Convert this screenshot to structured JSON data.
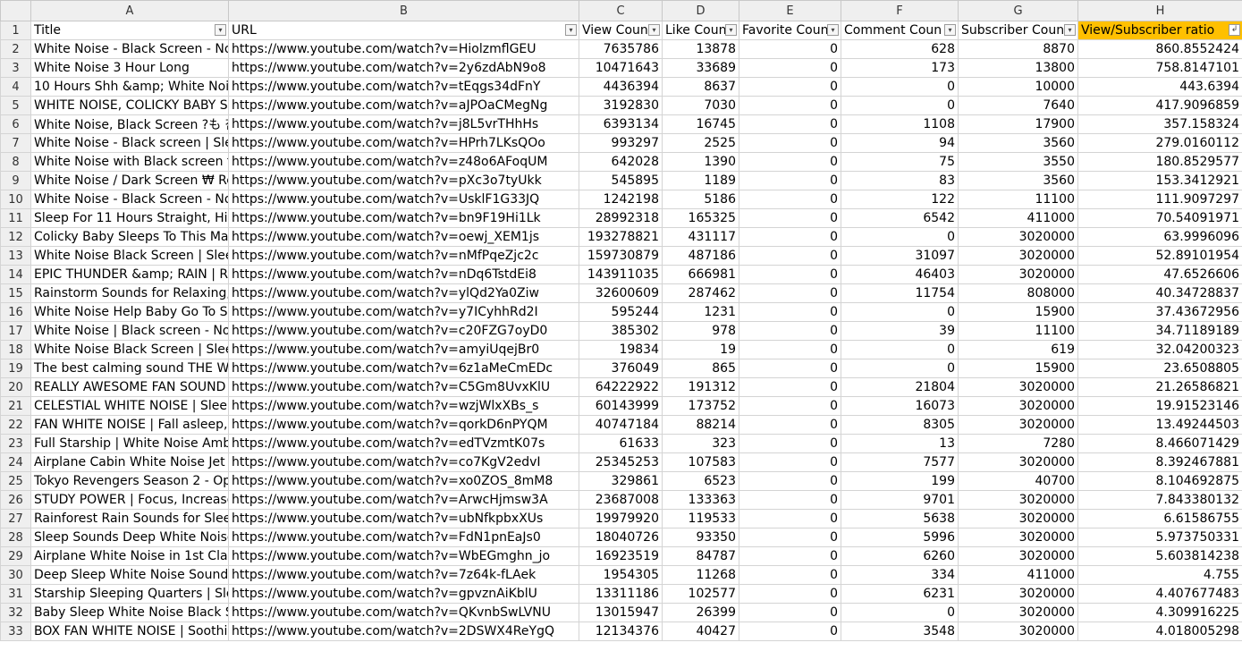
{
  "columns": [
    "A",
    "B",
    "C",
    "D",
    "E",
    "F",
    "G",
    "H"
  ],
  "field_headers": [
    "Title",
    "URL",
    "View Coun",
    "Like Coun",
    "Favorite Coun",
    "Comment Coun",
    "Subscriber Coun",
    "View/Subscriber ratio"
  ],
  "filter_icons": {
    "dropdown": "▾",
    "sorted_desc": "↲"
  },
  "highlight_color": "#ffc000",
  "rows": [
    {
      "n": "2",
      "cells": [
        "White Noise - Black Screen - No",
        "https://www.youtube.com/watch?v=HiolzmflGEU",
        "7635786",
        "13878",
        "0",
        "628",
        "8870",
        "860.8552424"
      ]
    },
    {
      "n": "3",
      "cells": [
        "White Noise 3 Hour Long",
        "https://www.youtube.com/watch?v=2y6zdAbN9o8",
        "10471643",
        "33689",
        "0",
        "173",
        "13800",
        "758.8147101"
      ]
    },
    {
      "n": "4",
      "cells": [
        "10 Hours Shh &amp; White Nois",
        "https://www.youtube.com/watch?v=tEqgs34dFnY",
        "4436394",
        "8637",
        "0",
        "0",
        "10000",
        "443.6394"
      ]
    },
    {
      "n": "5",
      "cells": [
        "WHITE NOISE, COLICKY BABY SL",
        "https://www.youtube.com/watch?v=aJPOaCMegNg",
        "3192830",
        "7030",
        "0",
        "0",
        "7640",
        "417.9096859"
      ]
    },
    {
      "n": "6",
      "cells": [
        "White Noise, Black Screen ?も 참",
        "https://www.youtube.com/watch?v=j8L5vrTHhHs",
        "6393134",
        "16745",
        "0",
        "1108",
        "17900",
        "357.158324"
      ]
    },
    {
      "n": "7",
      "cells": [
        "White Noise - Black screen | Sle",
        "https://www.youtube.com/watch?v=HPrh7LKsQOo",
        "993297",
        "2525",
        "0",
        "94",
        "3560",
        "279.0160112"
      ]
    },
    {
      "n": "8",
      "cells": [
        "White Noise with Black screen fo",
        "https://www.youtube.com/watch?v=z48o6AFoqUM",
        "642028",
        "1390",
        "0",
        "75",
        "3550",
        "180.8529577"
      ]
    },
    {
      "n": "9",
      "cells": [
        "White Noise / Dark Screen ₩ Re",
        "https://www.youtube.com/watch?v=pXc3o7tyUkk",
        "545895",
        "1189",
        "0",
        "83",
        "3560",
        "153.3412921"
      ]
    },
    {
      "n": "10",
      "cells": [
        "White Noise - Black Screen - No",
        "https://www.youtube.com/watch?v=UsklF1G33JQ",
        "1242198",
        "5186",
        "0",
        "122",
        "11100",
        "111.9097297"
      ]
    },
    {
      "n": "11",
      "cells": [
        "Sleep For 11 Hours Straight, High",
        "https://www.youtube.com/watch?v=bn9F19Hi1Lk",
        "28992318",
        "165325",
        "0",
        "6542",
        "411000",
        "70.54091971"
      ]
    },
    {
      "n": "12",
      "cells": [
        "Colicky Baby Sleeps To This Ma",
        "https://www.youtube.com/watch?v=oewj_XEM1js",
        "193278821",
        "431117",
        "0",
        "0",
        "3020000",
        "63.9996096"
      ]
    },
    {
      "n": "13",
      "cells": [
        "White Noise Black Screen | Slee",
        "https://www.youtube.com/watch?v=nMfPqeZjc2c",
        "159730879",
        "487186",
        "0",
        "31097",
        "3020000",
        "52.89101954"
      ]
    },
    {
      "n": "14",
      "cells": [
        "EPIC THUNDER &amp; RAIN | R",
        "https://www.youtube.com/watch?v=nDq6TstdEi8",
        "143911035",
        "666981",
        "0",
        "46403",
        "3020000",
        "47.6526606"
      ]
    },
    {
      "n": "15",
      "cells": [
        "Rainstorm Sounds for Relaxing,",
        "https://www.youtube.com/watch?v=ylQd2Ya0Ziw",
        "32600609",
        "287462",
        "0",
        "11754",
        "808000",
        "40.34728837"
      ]
    },
    {
      "n": "16",
      "cells": [
        "White Noise Help Baby Go To S",
        "https://www.youtube.com/watch?v=y7ICyhhRd2I",
        "595244",
        "1231",
        "0",
        "0",
        "15900",
        "37.43672956"
      ]
    },
    {
      "n": "17",
      "cells": [
        "White Noise | Black screen - No",
        "https://www.youtube.com/watch?v=c20FZG7oyD0",
        "385302",
        "978",
        "0",
        "39",
        "11100",
        "34.71189189"
      ]
    },
    {
      "n": "18",
      "cells": [
        "White Noise Black Screen | Slee",
        "https://www.youtube.com/watch?v=amyiUqejBr0",
        "19834",
        "19",
        "0",
        "0",
        "619",
        "32.04200323"
      ]
    },
    {
      "n": "19",
      "cells": [
        "The best calming sound THE WH",
        "https://www.youtube.com/watch?v=6z1aMeCmEDc",
        "376049",
        "865",
        "0",
        "0",
        "15900",
        "23.6508805"
      ]
    },
    {
      "n": "20",
      "cells": [
        "REALLY AWESOME FAN SOUND",
        "https://www.youtube.com/watch?v=C5Gm8UvxKlU",
        "64222922",
        "191312",
        "0",
        "21804",
        "3020000",
        "21.26586821"
      ]
    },
    {
      "n": "21",
      "cells": [
        "CELESTIAL WHITE NOISE | Sleep",
        "https://www.youtube.com/watch?v=wzjWlxXBs_s",
        "60143999",
        "173752",
        "0",
        "16073",
        "3020000",
        "19.91523146"
      ]
    },
    {
      "n": "22",
      "cells": [
        "FAN WHITE NOISE | Fall asleep,",
        "https://www.youtube.com/watch?v=qorkD6nPYQM",
        "40747184",
        "88214",
        "0",
        "8305",
        "3020000",
        "13.49244503"
      ]
    },
    {
      "n": "23",
      "cells": [
        "Full Starship | White Noise Amb",
        "https://www.youtube.com/watch?v=edTVzmtK07s",
        "61633",
        "323",
        "0",
        "13",
        "7280",
        "8.466071429"
      ]
    },
    {
      "n": "24",
      "cells": [
        "Airplane Cabin White Noise Jet",
        "https://www.youtube.com/watch?v=co7KgV2edvI",
        "25345253",
        "107583",
        "0",
        "7577",
        "3020000",
        "8.392467881"
      ]
    },
    {
      "n": "25",
      "cells": [
        "Tokyo Revengers Season 2 - Op",
        "https://www.youtube.com/watch?v=xo0ZOS_8mM8",
        "329861",
        "6523",
        "0",
        "199",
        "40700",
        "8.104692875"
      ]
    },
    {
      "n": "26",
      "cells": [
        "STUDY POWER | Focus, Increase",
        "https://www.youtube.com/watch?v=ArwcHjmsw3A",
        "23687008",
        "133363",
        "0",
        "9701",
        "3020000",
        "7.843380132"
      ]
    },
    {
      "n": "27",
      "cells": [
        "Rainforest Rain Sounds for Sleep",
        "https://www.youtube.com/watch?v=ubNfkpbxXUs",
        "19979920",
        "119533",
        "0",
        "5638",
        "3020000",
        "6.61586755"
      ]
    },
    {
      "n": "28",
      "cells": [
        "Sleep Sounds Deep White Noise",
        "https://www.youtube.com/watch?v=FdN1pnEaJs0",
        "18040726",
        "93350",
        "0",
        "5996",
        "3020000",
        "5.973750331"
      ]
    },
    {
      "n": "29",
      "cells": [
        "Airplane White Noise in 1st Clas",
        "https://www.youtube.com/watch?v=WbEGmghn_jo",
        "16923519",
        "84787",
        "0",
        "6260",
        "3020000",
        "5.603814238"
      ]
    },
    {
      "n": "30",
      "cells": [
        "Deep Sleep White Noise Sounds",
        "https://www.youtube.com/watch?v=7z64k-fLAek",
        "1954305",
        "11268",
        "0",
        "334",
        "411000",
        "4.755"
      ]
    },
    {
      "n": "31",
      "cells": [
        "Starship Sleeping Quarters |  Sle",
        "https://www.youtube.com/watch?v=gpvznAiKblU",
        "13311186",
        "102577",
        "0",
        "6231",
        "3020000",
        "4.407677483"
      ]
    },
    {
      "n": "32",
      "cells": [
        "Baby Sleep White Noise Black S",
        "https://www.youtube.com/watch?v=QKvnbSwLVNU",
        "13015947",
        "26399",
        "0",
        "0",
        "3020000",
        "4.309916225"
      ]
    },
    {
      "n": "33",
      "cells": [
        "BOX FAN WHITE NOISE | Soothi",
        "https://www.youtube.com/watch?v=2DSWX4ReYgQ",
        "12134376",
        "40427",
        "0",
        "3548",
        "3020000",
        "4.018005298"
      ]
    }
  ]
}
